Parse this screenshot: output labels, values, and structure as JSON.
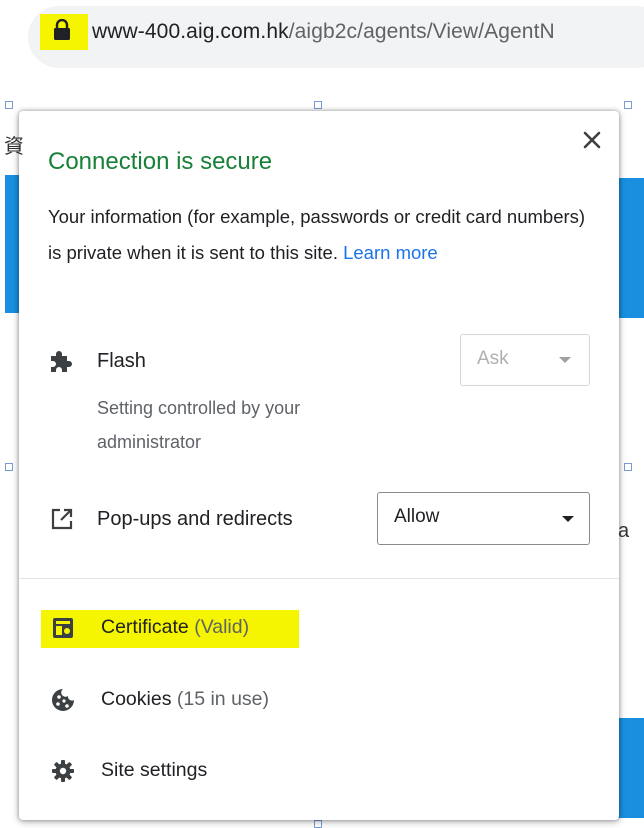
{
  "address_bar": {
    "domain": "www-400.aig.com.hk",
    "path": "/aigb2c/agents/View/AgentN",
    "icon": "lock-icon"
  },
  "popup": {
    "title": "Connection is secure",
    "description": "Your information (for example, passwords or credit card numbers) is private when it is sent to this site.",
    "learn_more": "Learn more",
    "close_icon": "close-icon",
    "permissions": [
      {
        "icon": "puzzle-piece-icon",
        "label": "Flash",
        "subtext": "Setting controlled by your administrator",
        "value": "Ask",
        "enabled": false
      },
      {
        "icon": "open-in-new-icon",
        "label": "Pop-ups and redirects",
        "value": "Allow",
        "enabled": true
      }
    ],
    "links": [
      {
        "icon": "certificate-icon",
        "label": "Certificate",
        "status": "(Valid)",
        "highlighted": true
      },
      {
        "icon": "cookie-icon",
        "label": "Cookies",
        "status": "(15 in use)",
        "highlighted": false
      },
      {
        "icon": "gear-icon",
        "label": "Site settings",
        "status": "",
        "highlighted": false
      }
    ]
  },
  "colors": {
    "secure_green": "#188038",
    "link_blue": "#1a73e8",
    "highlight_yellow": "#f5f500"
  }
}
